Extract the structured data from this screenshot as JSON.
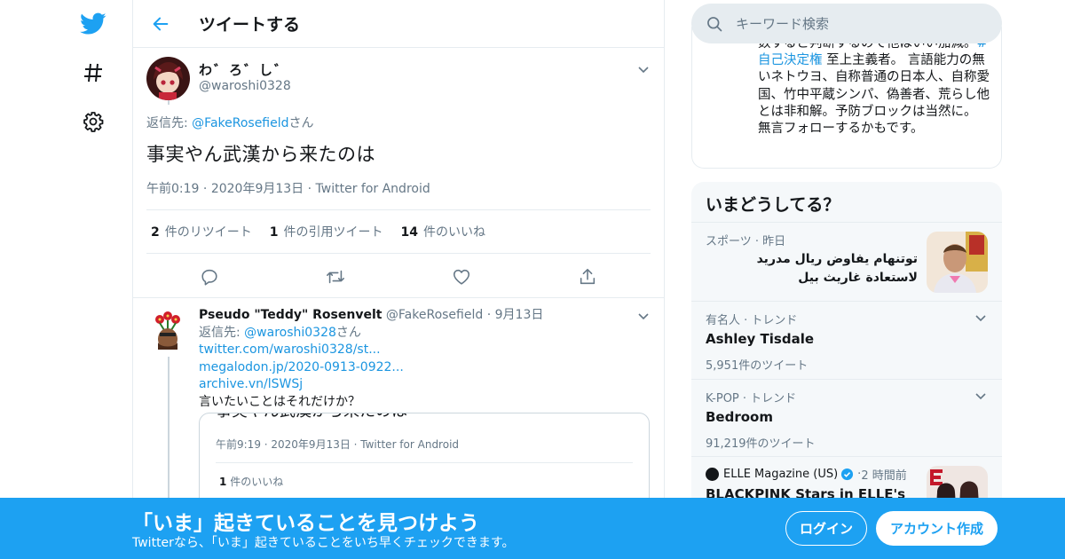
{
  "colors": {
    "accent": "#1da1f2",
    "link": "#1b95e0",
    "text": "#14171a",
    "muted": "#657786",
    "border": "#e6ecf0"
  },
  "nav": {
    "icons": [
      "twitter-bird-icon",
      "hashtag-icon",
      "gear-icon"
    ]
  },
  "header": {
    "title": "ツイートする"
  },
  "main_tweet": {
    "display_name": "わ゛ろ゛し゛",
    "handle": "@waroshi0328",
    "reply_prefix": "返信先: ",
    "reply_handle": "@FakeRosefield",
    "reply_suffix": "さん",
    "text": "事実やん武漢から来たのは",
    "time": "午前0:19",
    "date": "2020年9月13日",
    "source": "Twitter for Android",
    "stats": {
      "retweets_count": "2",
      "retweets_label": "件のリツイート",
      "quotes_count": "1",
      "quotes_label": "件の引用ツイート",
      "likes_count": "14",
      "likes_label": "件のいいね"
    }
  },
  "reply_tweet": {
    "display_name": "Pseudo \"Teddy\" Rosenvelt",
    "handle": "@FakeRosefield",
    "date": "9月13日",
    "reply_prefix": "返信先: ",
    "reply_handle": "@waroshi0328",
    "reply_suffix": "さん",
    "link1": "twitter.com/waroshi0328/st...",
    "link2": "megalodon.jp/2020-0913-0922...",
    "link3": "archive.vn/lSWSj",
    "text": "言いたいことはそれだけか？",
    "quote": {
      "text": "事実やん武漢から来たのは",
      "meta": "午前9:19 · 2020年9月13日 · Twitter for Android",
      "likes_count": "1",
      "likes_label": "件のいいね"
    }
  },
  "search": {
    "placeholder": "キーワード検索"
  },
  "bio": {
    "line1": "数するど判断するので他はいい加",
    "line2_pre": "減。",
    "hashtag": "#自己決定権",
    "line2_post": " 至上主義者。 言語能力の無いネトウヨ、自称普通の日本人、自称愛国、竹中平蔵シンパ、偽善者、荒らし他とは非和解。予防ブロックは当然に。 無言フォローするかもです。"
  },
  "trends": {
    "title": "いまどうしてる？",
    "items": [
      {
        "category": "スポーツ · 昨日",
        "headline": "توتنهام يفاوض ريال مدريد لاستعادة غاريث بيل"
      },
      {
        "category": "有名人 · トレンド",
        "name": "Ashley Tisdale",
        "count": "5,951件のツイート"
      },
      {
        "category": "K-POP · トレンド",
        "name": "Bedroom",
        "count": "91,219件のツイート"
      },
      {
        "source": "ELLE Magazine (US)",
        "time": "2 時間前",
        "headline": "BLACKPINK Stars in ELLE's"
      }
    ]
  },
  "banner": {
    "title": "「いま」起きていることを見つけよう",
    "subtitle": "Twitterなら、「いま」起きていることをいち早くチェックできます。",
    "login_label": "ログイン",
    "signup_label": "アカウント作成"
  }
}
